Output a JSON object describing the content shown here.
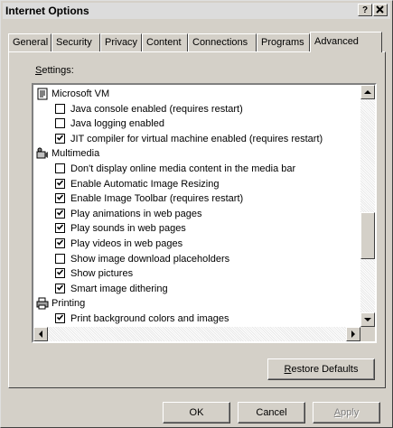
{
  "window": {
    "title": "Internet Options",
    "help_button": "?",
    "close_button": "X"
  },
  "tabs": [
    {
      "label": "General",
      "active": false
    },
    {
      "label": "Security",
      "active": false
    },
    {
      "label": "Privacy",
      "active": false
    },
    {
      "label": "Content",
      "active": false
    },
    {
      "label": "Connections",
      "active": false
    },
    {
      "label": "Programs",
      "active": false
    },
    {
      "label": "Advanced",
      "active": true
    }
  ],
  "settings": {
    "label_mnemonic": "S",
    "label_rest": "ettings:",
    "items": [
      {
        "kind": "category",
        "icon": "document-icon",
        "label": "Microsoft VM"
      },
      {
        "kind": "checkbox",
        "checked": false,
        "label": "Java console enabled (requires restart)"
      },
      {
        "kind": "checkbox",
        "checked": false,
        "label": "Java logging enabled"
      },
      {
        "kind": "checkbox",
        "checked": true,
        "label": "JIT compiler for virtual machine enabled (requires restart)"
      },
      {
        "kind": "category",
        "icon": "multimedia-icon",
        "label": "Multimedia"
      },
      {
        "kind": "checkbox",
        "checked": false,
        "label": "Don't display online media content in the media bar"
      },
      {
        "kind": "checkbox",
        "checked": true,
        "label": "Enable Automatic Image Resizing"
      },
      {
        "kind": "checkbox",
        "checked": true,
        "label": "Enable Image Toolbar (requires restart)"
      },
      {
        "kind": "checkbox",
        "checked": true,
        "label": "Play animations in web pages"
      },
      {
        "kind": "checkbox",
        "checked": true,
        "label": "Play sounds in web pages"
      },
      {
        "kind": "checkbox",
        "checked": true,
        "label": "Play videos in web pages"
      },
      {
        "kind": "checkbox",
        "checked": false,
        "label": "Show image download placeholders"
      },
      {
        "kind": "checkbox",
        "checked": true,
        "label": "Show pictures"
      },
      {
        "kind": "checkbox",
        "checked": true,
        "label": "Smart image dithering"
      },
      {
        "kind": "category",
        "icon": "printer-icon",
        "label": "Printing"
      },
      {
        "kind": "checkbox",
        "checked": true,
        "label": "Print background colors and images"
      }
    ]
  },
  "buttons": {
    "restore_mnemonic": "R",
    "restore_rest": "estore Defaults",
    "ok": "OK",
    "cancel": "Cancel",
    "apply_mnemonic": "A",
    "apply_rest": "pply",
    "apply_enabled": false
  }
}
